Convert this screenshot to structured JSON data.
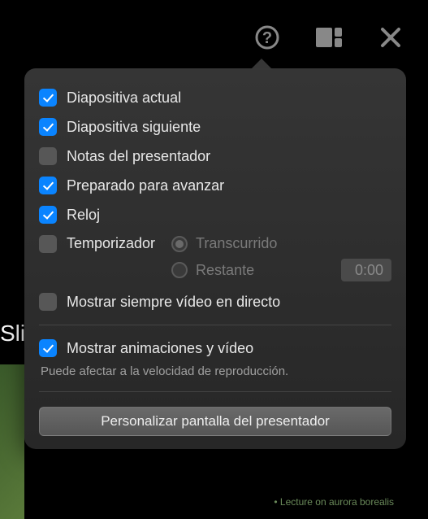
{
  "background": {
    "partial_text": "Sli"
  },
  "options": {
    "current_slide": {
      "label": "Diapositiva actual",
      "checked": true
    },
    "next_slide": {
      "label": "Diapositiva siguiente",
      "checked": true
    },
    "presenter_notes": {
      "label": "Notas del presentador",
      "checked": false
    },
    "ready_advance": {
      "label": "Preparado para avanzar",
      "checked": true
    },
    "clock": {
      "label": "Reloj",
      "checked": true
    },
    "timer": {
      "label": "Temporizador",
      "checked": false,
      "elapsed_label": "Transcurrido",
      "remaining_label": "Restante",
      "selected": "elapsed",
      "time_value": "0:00"
    },
    "always_show_live": {
      "label": "Mostrar siempre vídeo en directo",
      "checked": false
    },
    "show_animations": {
      "label": "Mostrar animaciones y vídeo",
      "checked": true
    }
  },
  "hint": "Puede afectar a la velocidad de reproducción.",
  "customize_button": "Personalizar pantalla del presentador",
  "footer": "• Lecture on aurora borealis"
}
